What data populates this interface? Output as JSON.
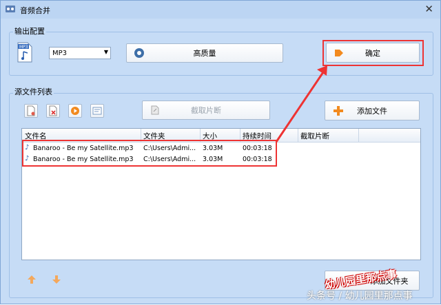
{
  "window": {
    "title": "音频合并",
    "close": "✕"
  },
  "output_group": {
    "label": "输出配置",
    "format_icon_text": "MP3",
    "format_value": "MP3",
    "quality_button": "高质量",
    "ok_button": "确定"
  },
  "source_group": {
    "label": "源文件列表",
    "clip_button": "截取片断",
    "add_button": "添加文件",
    "add_button_bottom": "添加文件夹"
  },
  "table": {
    "headers": [
      "文件名",
      "文件夹",
      "大小",
      "持续时间",
      "截取片断"
    ],
    "rows": [
      {
        "name": "Banaroo - Be my Satellite.mp3",
        "folder": "C:\\Users\\Admi...",
        "size": "3.03M",
        "duration": "00:03:18",
        "clip": ""
      },
      {
        "name": "Banaroo - Be my Satellite.mp3",
        "folder": "C:\\Users\\Admi...",
        "size": "3.03M",
        "duration": "00:03:18",
        "clip": ""
      }
    ]
  },
  "watermark": {
    "stamp": "幼儿园里那点事",
    "bottom": "头条号 / 幼儿园里那点事"
  },
  "colors": {
    "highlight": "#e33333",
    "accent_orange": "#f28a1e"
  }
}
